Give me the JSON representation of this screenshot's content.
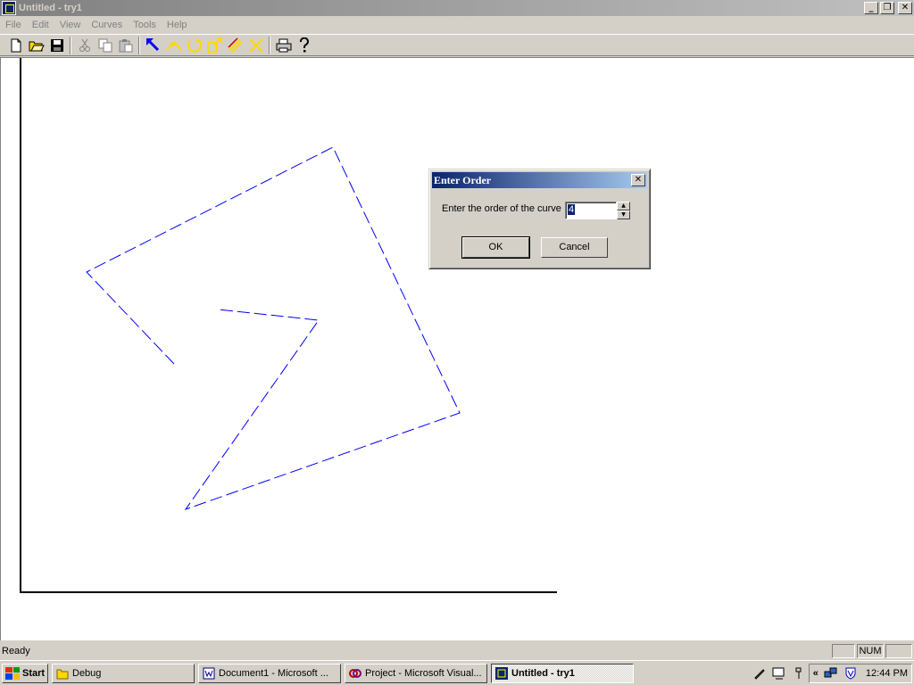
{
  "window": {
    "title": "Untitled - try1",
    "caption_buttons": {
      "minimize": "_",
      "restore": "❐",
      "close": "✕"
    }
  },
  "menu": [
    "File",
    "Edit",
    "View",
    "Curves",
    "Tools",
    "Help"
  ],
  "toolbar": {
    "buttons": [
      {
        "name": "new-file-icon"
      },
      {
        "name": "open-folder-icon"
      },
      {
        "name": "save-icon"
      },
      {
        "name": "cut-icon"
      },
      {
        "name": "copy-icon"
      },
      {
        "name": "paste-icon"
      },
      {
        "name": "select-arrow-icon"
      },
      {
        "name": "draw-curve-icon"
      },
      {
        "name": "rotate-icon"
      },
      {
        "name": "scale-icon"
      },
      {
        "name": "parallel-lines-icon"
      },
      {
        "name": "delete-icon"
      },
      {
        "name": "print-icon"
      },
      {
        "name": "help-icon"
      }
    ],
    "colors": {
      "blue": "#0000ff",
      "yellow": "#ffd800",
      "gray": "#808080"
    }
  },
  "canvas": {
    "polyline_color": "#0000ff",
    "axis_color": "#000000"
  },
  "dialog": {
    "title": "Enter Order",
    "close": "✕",
    "label": "Enter the order of the curve",
    "input_value": "4",
    "spin_up": "▲",
    "spin_down": "▼",
    "ok_label": "OK",
    "cancel_label": "Cancel"
  },
  "status": {
    "text": "Ready",
    "panes": [
      "",
      "NUM",
      ""
    ]
  },
  "taskbar": {
    "start_label": "Start",
    "tasks": [
      {
        "label": "Debug",
        "icon": "folder-icon",
        "active": false
      },
      {
        "label": "Document1 - Microsoft ...",
        "icon": "word-icon",
        "active": false
      },
      {
        "label": "Project - Microsoft Visual...",
        "icon": "visual-studio-icon",
        "active": false
      },
      {
        "label": "Untitled - try1",
        "icon": "app-icon",
        "active": true
      }
    ],
    "tray_chevron": "«",
    "clock": "12:44 PM"
  }
}
